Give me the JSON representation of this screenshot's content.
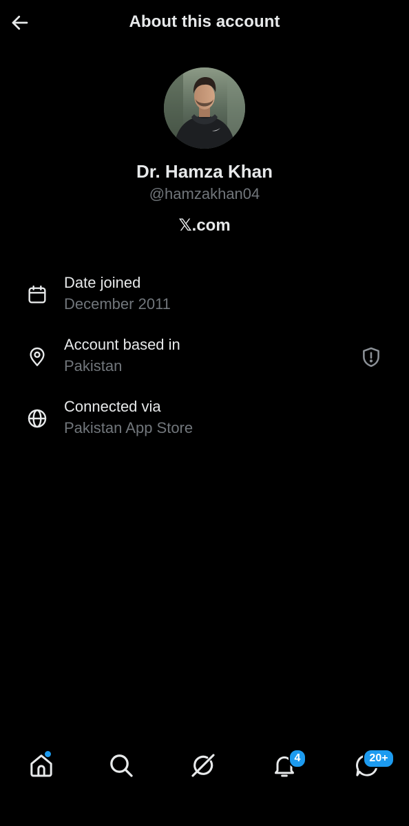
{
  "header": {
    "title": "About this account",
    "back_icon": "arrow-left-icon"
  },
  "profile": {
    "display_name": "Dr. Hamza Khan",
    "handle": "@hamzakhan04",
    "domain": "𝕏.com"
  },
  "info": [
    {
      "icon": "calendar-icon",
      "label": "Date joined",
      "value": "December 2011"
    },
    {
      "icon": "location-pin-icon",
      "label": "Account based in",
      "value": "Pakistan",
      "action_icon": "shield-alert-icon"
    },
    {
      "icon": "globe-icon",
      "label": "Connected via",
      "value": "Pakistan App Store"
    }
  ],
  "nav": {
    "items": [
      {
        "icon": "home-icon",
        "has_dot": true
      },
      {
        "icon": "search-icon"
      },
      {
        "icon": "grok-icon"
      },
      {
        "icon": "bell-icon",
        "badge": "4"
      },
      {
        "icon": "messages-icon",
        "badge": "20+"
      }
    ]
  },
  "colors": {
    "background": "#000000",
    "text_primary": "#e7e9ea",
    "text_secondary": "#71767b",
    "accent": "#1d9bf0"
  }
}
